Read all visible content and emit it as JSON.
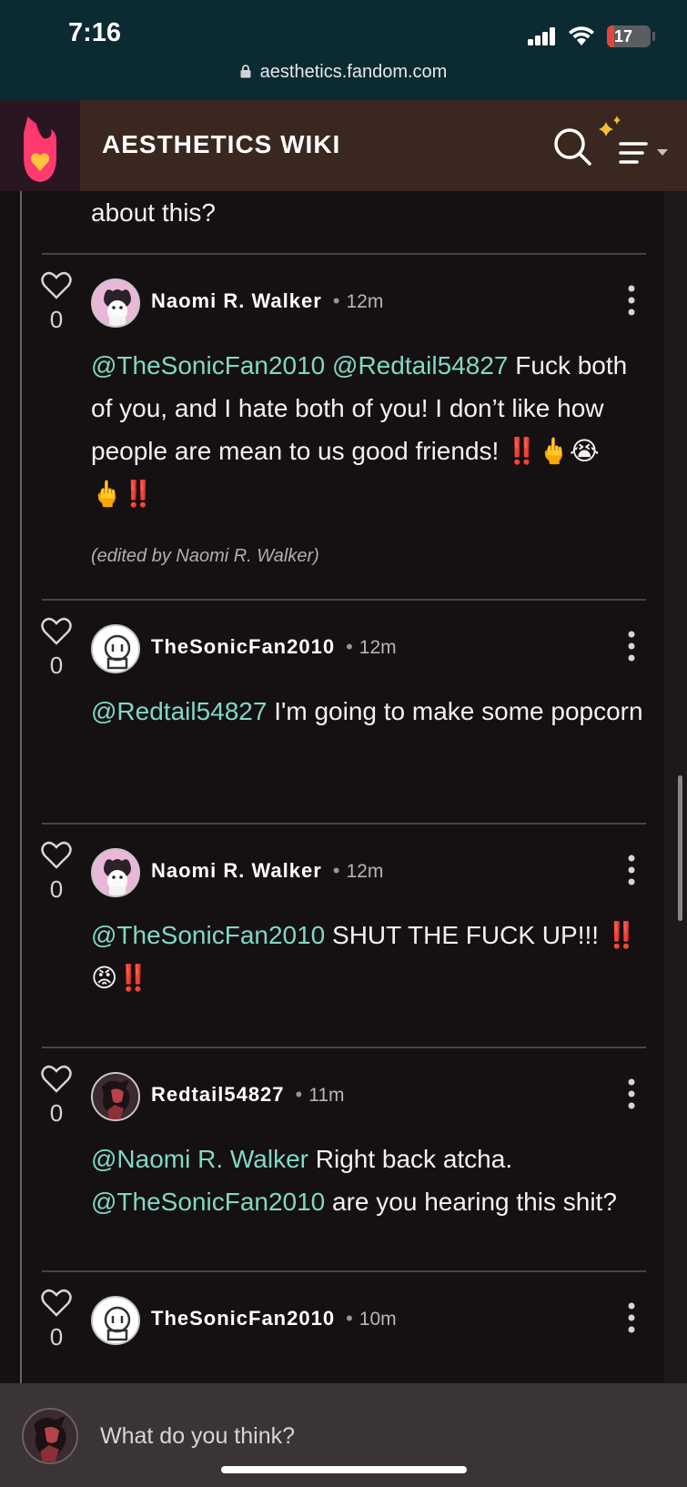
{
  "status_bar": {
    "time": "7:16",
    "battery_level": "17",
    "battery_fraction": 0.17,
    "url": "aesthetics.fandom.com",
    "icons": [
      "signal-icon",
      "wifi-icon",
      "battery-icon",
      "lock-icon"
    ]
  },
  "header": {
    "title": "AESTHETICS WIKI",
    "icons": [
      "fandom-logo-icon",
      "search-icon",
      "sparkle-menu-icon"
    ],
    "accent_color": "#ff2c6a"
  },
  "thread": {
    "prev_text": "about this?",
    "comments": [
      {
        "author": "Naomi R. Walker",
        "time": "12m",
        "likes": "0",
        "mentions": [
          "@TheSonicFan2010",
          "@Redtail54827"
        ],
        "text": "Fuck both of you, and I hate both of you! I don’t like how people are mean to us good friends!",
        "emojis": "‼️🖕😭🖕‼️",
        "edited": "(edited by Naomi R. Walker)"
      },
      {
        "author": "TheSonicFan2010",
        "time": "12m",
        "likes": "0",
        "mentions": [
          "@Redtail54827"
        ],
        "text": "I'm going to make some popcorn"
      },
      {
        "author": "Naomi R. Walker",
        "time": "12m",
        "likes": "0",
        "mentions": [
          "@TheSonicFan2010"
        ],
        "text": "SHUT THE FUCK UP!!!",
        "emojis": "‼️😡‼️"
      },
      {
        "author": "Redtail54827",
        "time": "11m",
        "likes": "0",
        "mentions": [
          "@Naomi R. Walker",
          "@TheSonicFan2010"
        ],
        "text": "Right back atcha.",
        "text2": "are you hearing this shit?"
      },
      {
        "author": "TheSonicFan2010",
        "time": "10m",
        "likes": "0"
      }
    ]
  },
  "reply": {
    "placeholder": "What do you think?"
  },
  "colors": {
    "mention": "#7fd9c4",
    "background": "#151011",
    "header_bg": "#3a2820",
    "status_bg": "#0c2a31"
  }
}
